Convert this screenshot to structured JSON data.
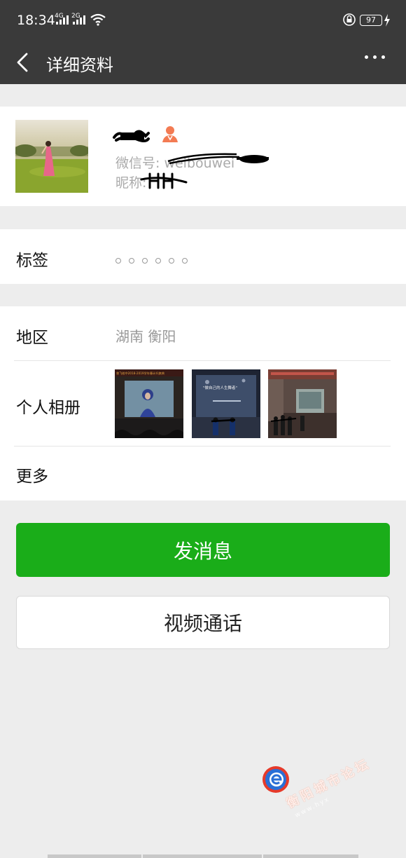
{
  "status_bar": {
    "time": "18:34",
    "net1": "4G",
    "net2": "2G",
    "battery": "97"
  },
  "header": {
    "title": "详细资料"
  },
  "profile": {
    "name": "",
    "wechat_id_label": "微信号: weibouwei",
    "nickname_label": "昵称: "
  },
  "tags": {
    "label": "标签"
  },
  "region": {
    "label": "地区",
    "value": "湖南  衡阳"
  },
  "album": {
    "label": "个人相册",
    "photo1_caption": "曾飞校中2018-2019学年春计升旗典",
    "photo2_caption": "\"做自己的人生舞者\""
  },
  "more": {
    "label": "更多"
  },
  "actions": {
    "send_message": "发消息",
    "video_call": "视频通话"
  },
  "watermark": {
    "text": "衡阳城市论坛",
    "url": "www.hyx"
  },
  "colors": {
    "header_bg": "#3a3a3a",
    "primary_button": "#1aad19",
    "gender_icon": "#f37b53"
  }
}
